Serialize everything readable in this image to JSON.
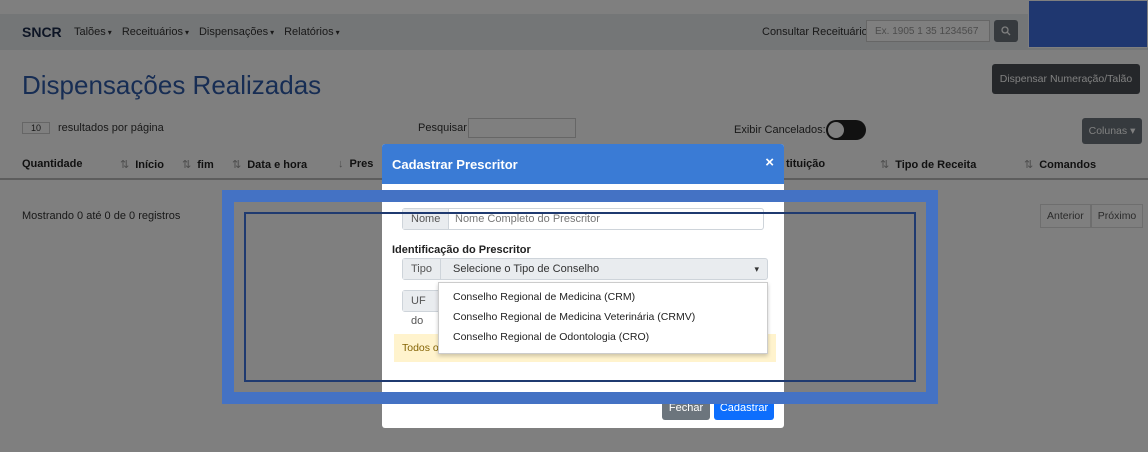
{
  "navbar": {
    "brand": "SNCR",
    "menu": [
      "Talões",
      "Receituários",
      "Dispensações",
      "Relatórios"
    ],
    "consult_label": "Consultar Receituário:",
    "consult_placeholder": "Ex. 1905 1 35 1234567"
  },
  "page": {
    "title": "Dispensações Realizadas",
    "dispensar_button": "Dispensar Numeração/Talão",
    "per_page_value": "10",
    "per_page_label": "resultados por página",
    "search_label": "Pesquisar",
    "show_cancelled_label": "Exibir Cancelados:",
    "columns_button": "Colunas",
    "table_headers": [
      "Quantidade",
      "Início",
      "fim",
      "Data e hora",
      "Pres",
      "tituição",
      "Tipo de Receita",
      "Comandos"
    ],
    "showing_text": "Mostrando 0 até 0 de 0 registros",
    "pager_prev": "Anterior",
    "pager_next": "Próximo"
  },
  "modal": {
    "title": "Cadastrar Prescritor",
    "close_symbol": "×",
    "name_addon": "Nome",
    "name_placeholder": "Nome Completo do Prescritor",
    "section_title": "Identificação do Prescritor",
    "tipo_addon": "Tipo",
    "tipo_selected": "Selecione o Tipo de Conselho",
    "uf_addon": "UF do",
    "options": [
      "Conselho Regional de Medicina (CRM)",
      "Conselho Regional de Medicina Veterinária (CRMV)",
      "Conselho Regional de Odontologia (CRO)"
    ],
    "alert_text": "Todos os campos são de preenchimento obrigatório",
    "close_button": "Fechar",
    "submit_button": "Cadastrar"
  },
  "colors": {
    "primary": "#0d6efd",
    "header_blue": "#3a7bd5",
    "highlight_frame": "#4472c4",
    "title_blue": "#2e5ba8"
  }
}
